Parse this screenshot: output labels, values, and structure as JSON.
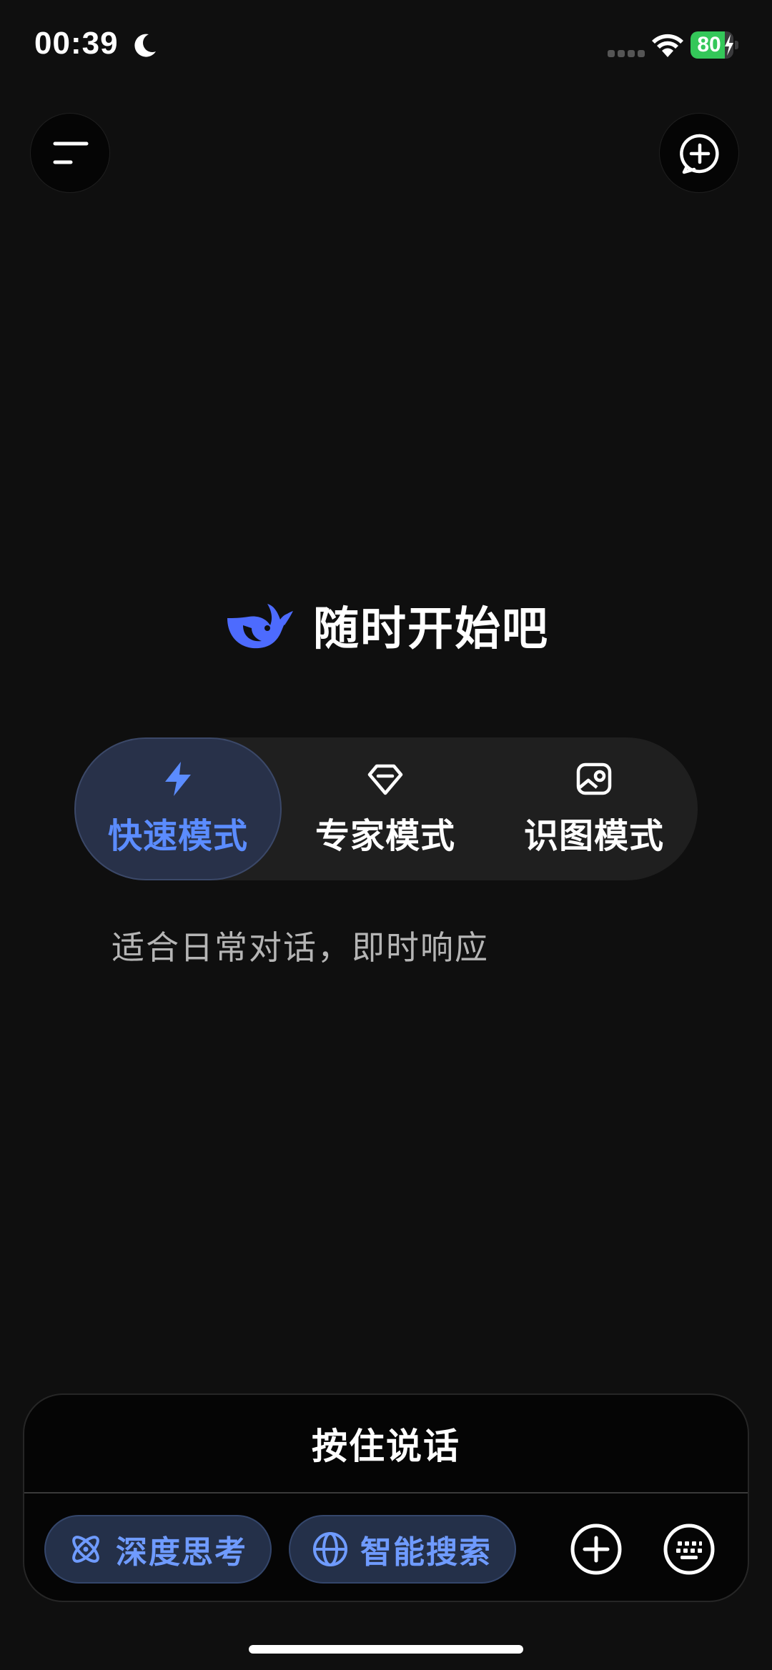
{
  "status_bar": {
    "time": "00:39",
    "battery_level": "80",
    "battery_fraction": 0.8
  },
  "welcome": {
    "title": "随时开始吧"
  },
  "modes": {
    "items": [
      {
        "label": "快速模式",
        "icon": "lightning-icon",
        "active": true
      },
      {
        "label": "专家模式",
        "icon": "diamond-icon",
        "active": false
      },
      {
        "label": "识图模式",
        "icon": "image-scan-icon",
        "active": false
      }
    ],
    "description": "适合日常对话，即时响应"
  },
  "input_panel": {
    "hold_to_talk_label": "按住说话",
    "chips": [
      {
        "label": "深度思考",
        "icon": "atom-icon"
      },
      {
        "label": "智能搜索",
        "icon": "globe-icon"
      }
    ]
  },
  "colors": {
    "background": "#0f0f0f",
    "accent": "#5b8cff",
    "active_mode_bg": "#283149",
    "chip_bg": "#243049",
    "battery_green": "#34c759"
  }
}
